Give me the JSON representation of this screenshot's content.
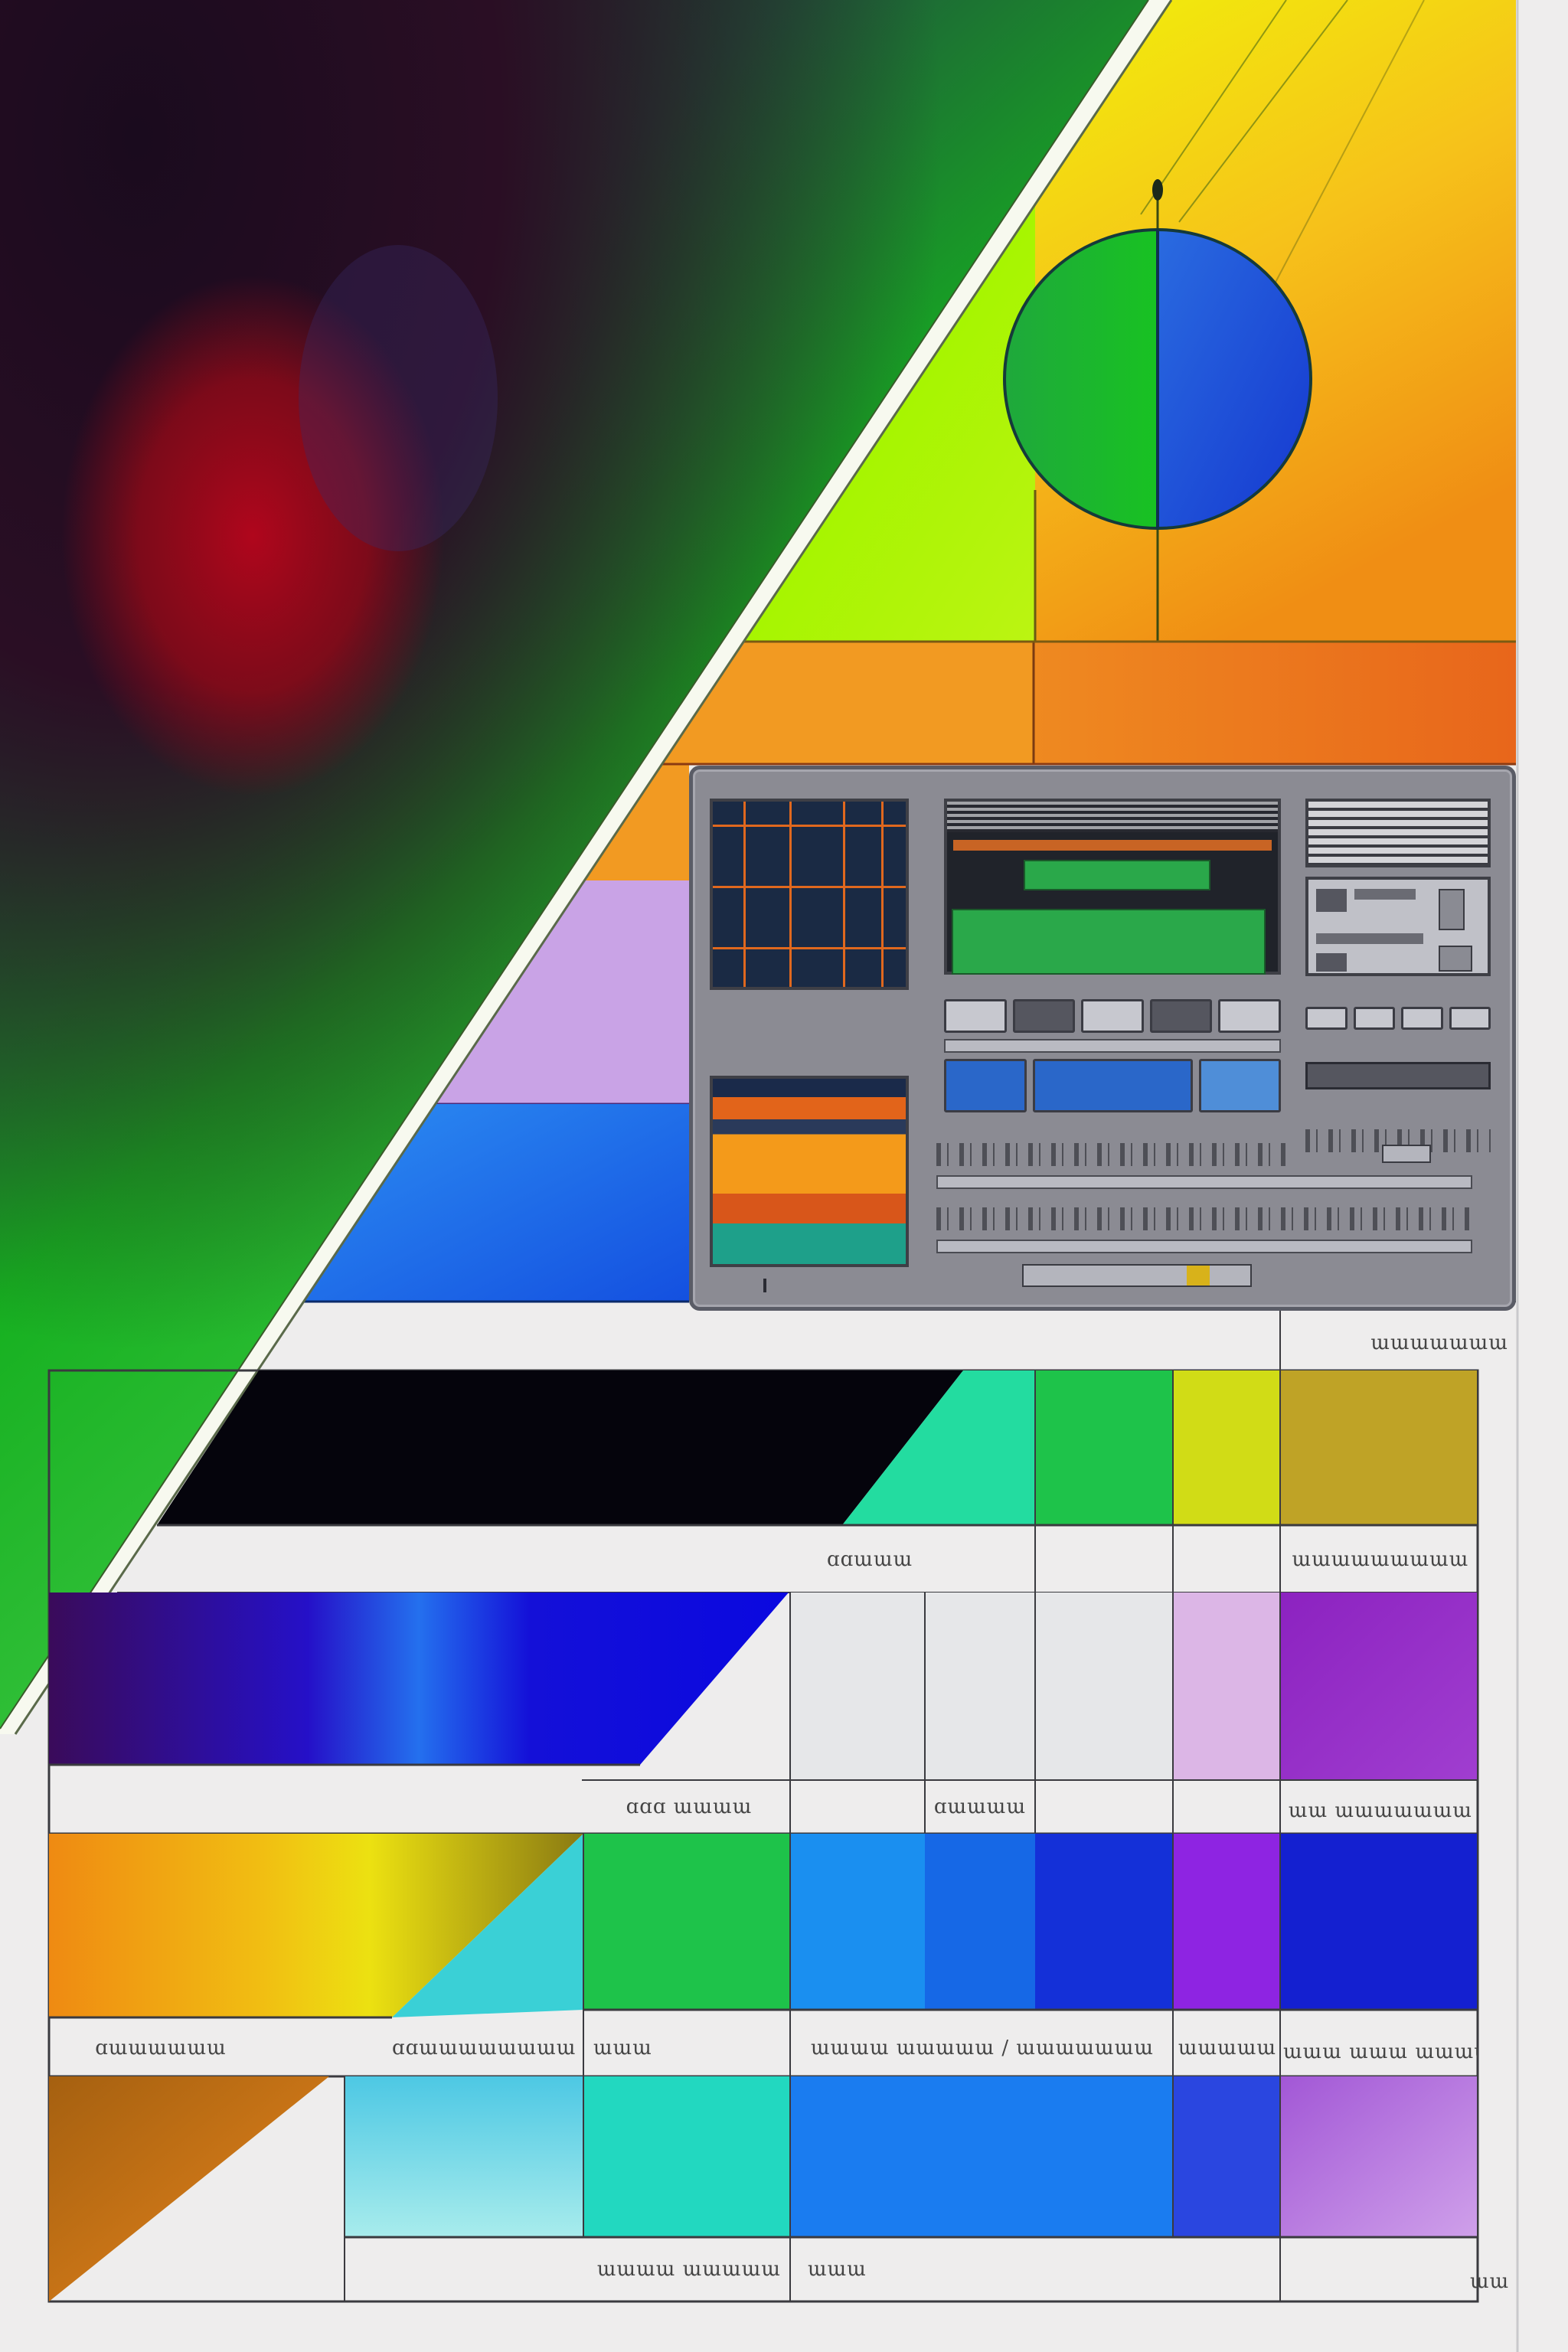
{
  "colors": {
    "background": "#eeeded",
    "prism_green": "#1fb81f",
    "prism_red": "#8c0a18",
    "lime": "#9bf500",
    "yellow": "#f6d61a",
    "orange": "#f07a13",
    "lavender": "#c9a3e6",
    "blue": "#1463e6",
    "black_band": "#05040c",
    "indigo": "#1a08c8",
    "violet": "#8a1fc4",
    "teal": "#23dca0",
    "green": "#1ec34a",
    "olive": "#bfa326"
  },
  "icons": {
    "globe": "globe-icon",
    "monitor": "control-panel-icon"
  },
  "labels": {
    "header_right": "ɯɯɯɯɯɯɯ",
    "row1_center": "ɑɑɯɯɯ",
    "row1_right": "ɯɯɯɯɯɯɯɯɯ",
    "row2_left": "ɑɑɑ ɯɯɯɯ",
    "row2_center": "ɑɯɯɯɯ",
    "row2_right": "ɯɯ ɯɯɯɯɯɯɯ",
    "row3_a": "ɑɯɯɯɯɯɯ",
    "row3_b": "ɑɑɯɯɯɯɯɯɯɯ",
    "row3_c": "ɯɯɯ",
    "row3_d": "ɯɯɯɯ ɯɯɯɯɯ / ɯɯɯɯɯɯɯ",
    "row3_e": "ɯɯɯɯɯ",
    "row3_f": "ɯɯɯ ɯɯɯ ɯɯɯɯɯ",
    "row4_a": "ɯɯɯɯ ɯɯɯɯɯ",
    "row4_b": "ɯɯɯ",
    "corner": "ɯɯ"
  }
}
